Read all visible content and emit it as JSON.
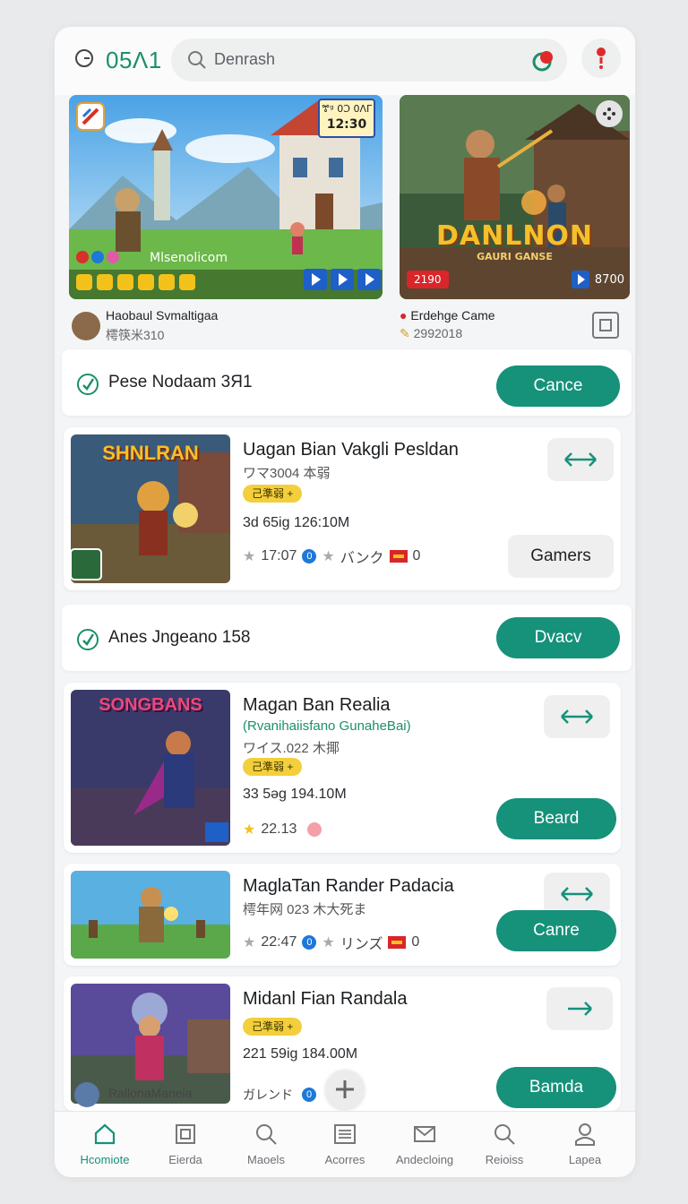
{
  "header": {
    "time": "05Λ1",
    "search_placeholder": "Denrash"
  },
  "banners": [
    {
      "badge_line1": "ꔅᵍ 0Ͻ 0ΛΓ",
      "badge_line2": "12:30",
      "overlay_label": "Mlsenolicom",
      "meta_title": "Haobaul Svmaltigaa",
      "meta_sub": "樗筷米310"
    },
    {
      "logo_line1": "DANLNON",
      "logo_line2": "GAURI GANSE",
      "badge_left": "2190",
      "badge_right": "8700",
      "meta_title": "Erdehge Came",
      "meta_sub": "2992018"
    }
  ],
  "sections": [
    {
      "title": "Pese Nodaam 3Я1",
      "button": "Cance"
    },
    {
      "title": "Anes Jngeano 158",
      "button": "Dvacv"
    }
  ],
  "cards": [
    {
      "thumb_label": "SHNLRAN",
      "title": "Uagan Bian Vakgli Pesldan",
      "sub": "ワマ3004 本弱",
      "tag": "己準弱 +",
      "size": "3d 65ig 126:10M",
      "rating": "17:07",
      "stat_o": "0",
      "stat_text": "バンク",
      "stat_count": "0",
      "button": "Gamers"
    },
    {
      "thumb_label": "SONGBANS",
      "title": "Magan Ban Realia",
      "sub_green": "(Rvanihaiisfano GunaheBai)",
      "sub": "ワイス.022 木揶",
      "tag": "己準弱 +",
      "size": "33 5əg 194.10M",
      "rating": "22.13",
      "button": "Beard"
    },
    {
      "title": "MaglaTan Rander Padacia",
      "sub": "樗年网 023 木大死ま",
      "rating": "22:47",
      "stat_o": "0",
      "stat_text": "リンズ",
      "stat_count": "0",
      "button": "Canre"
    },
    {
      "title": "Midanl Fian Randala",
      "tag": "己準弱 +",
      "size": "221 59ig 184.00M",
      "button": "Bamda"
    }
  ],
  "strip": {
    "title": "RallonaManeia",
    "sub": "RNK030",
    "label": "ガレンド",
    "badge": "0"
  },
  "nav": [
    {
      "label": "Hcomiote",
      "icon": "home-icon"
    },
    {
      "label": "Eierda",
      "icon": "square-icon"
    },
    {
      "label": "Maoels",
      "icon": "search-icon"
    },
    {
      "label": "Acorres",
      "icon": "list-icon"
    },
    {
      "label": "Andecloing",
      "icon": "mail-icon"
    },
    {
      "label": "Reioiss",
      "icon": "search-icon"
    },
    {
      "label": "Lapea",
      "icon": "user-icon"
    }
  ],
  "colors": {
    "accent": "#16917a",
    "tag_yellow": "#f3cf3b",
    "record_red": "#e02a2a"
  }
}
